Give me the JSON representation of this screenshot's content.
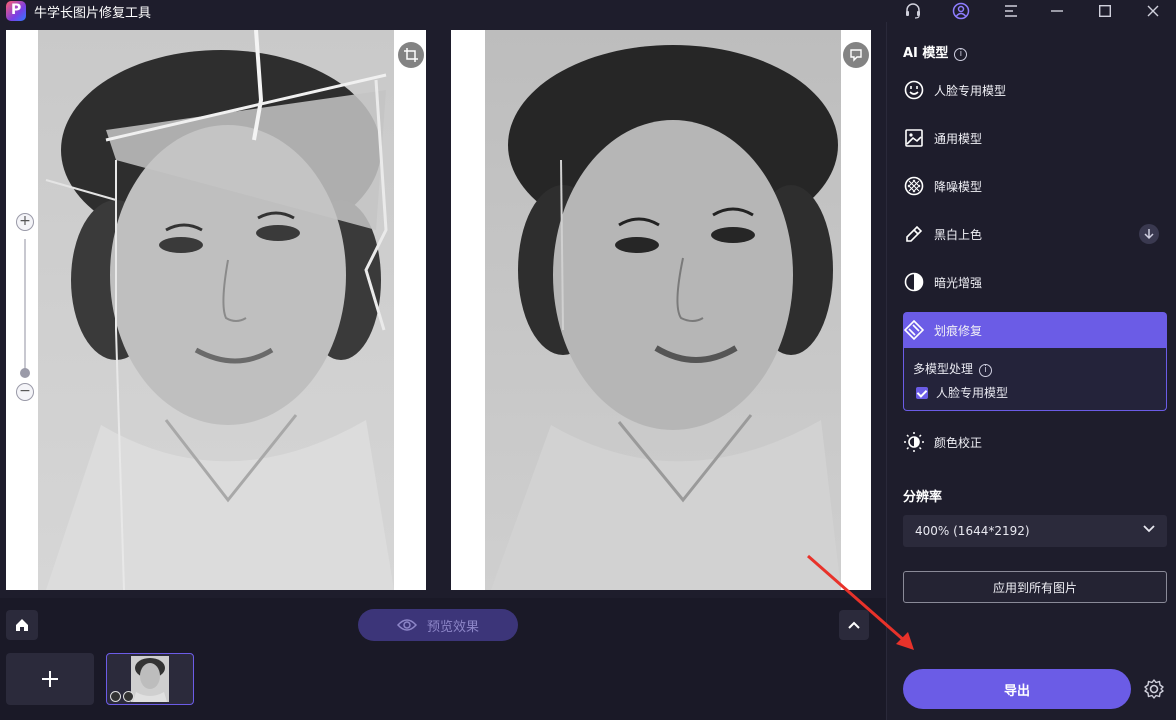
{
  "app": {
    "title": "牛学长图片修复工具"
  },
  "sidebar": {
    "ai_title": "AI 模型",
    "models": [
      {
        "label": "人脸专用模型",
        "icon": "face-icon"
      },
      {
        "label": "通用模型",
        "icon": "image-icon"
      },
      {
        "label": "降噪模型",
        "icon": "denoise-icon"
      },
      {
        "label": "黑白上色",
        "icon": "colorize-icon"
      },
      {
        "label": "暗光增强",
        "icon": "contrast-icon"
      },
      {
        "label": "划痕修复",
        "icon": "scratch-icon",
        "active": true
      },
      {
        "label": "颜色校正",
        "icon": "brightness-icon"
      }
    ],
    "multi": {
      "title": "多模型处理",
      "option": "人脸专用模型",
      "checked": true
    },
    "resolution_title": "分辨率",
    "resolution_value": "400% (1644*2192)",
    "apply_label": "应用到所有图片",
    "export_label": "导出"
  },
  "bottom": {
    "preview_label": "预览效果"
  },
  "colors": {
    "accent": "#6b5ce6",
    "background": "#1e1d2c",
    "annotation": "#e8322a"
  }
}
